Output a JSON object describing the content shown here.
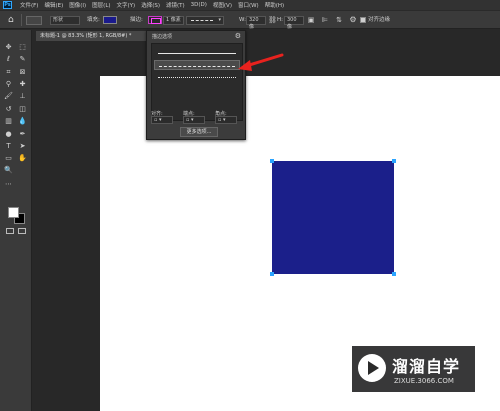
{
  "app": {
    "logo": "Ps"
  },
  "menu": [
    "文件(F)",
    "编辑(E)",
    "图像(I)",
    "图层(L)",
    "文字(Y)",
    "选择(S)",
    "滤镜(T)",
    "3D(D)",
    "视图(V)",
    "窗口(W)",
    "帮助(H)"
  ],
  "options": {
    "mode": "形状",
    "fill_label": "填充:",
    "fill_color": "#1a1a8c",
    "stroke_label": "描边:",
    "stroke_color": "#ff40ff",
    "stroke_width": "1 像素",
    "width_label": "W:",
    "width_value": "320 像",
    "height_label": "H:",
    "height_value": "300 像",
    "align_edges_label": "对齐边缘"
  },
  "document_tab": {
    "title": "未标题-1 @ 83.3% (矩形 1, RGB/8#) *",
    "close": "×"
  },
  "stroke_popup": {
    "title": "描边选项",
    "styles": [
      "solid",
      "dashed",
      "dotted"
    ],
    "selected_style": "dashed",
    "align_label": "对齐:",
    "caps_label": "端点:",
    "corners_label": "角点:",
    "more_button": "更多选项..."
  },
  "canvas": {
    "shape_color": "#1b1f8a"
  },
  "watermark": {
    "name": "溜溜自学",
    "url": "ZIXUE.3066.COM"
  },
  "icons": {
    "home": "home-icon",
    "gear": "gear-icon",
    "arrow": "red-arrow-annotation"
  }
}
